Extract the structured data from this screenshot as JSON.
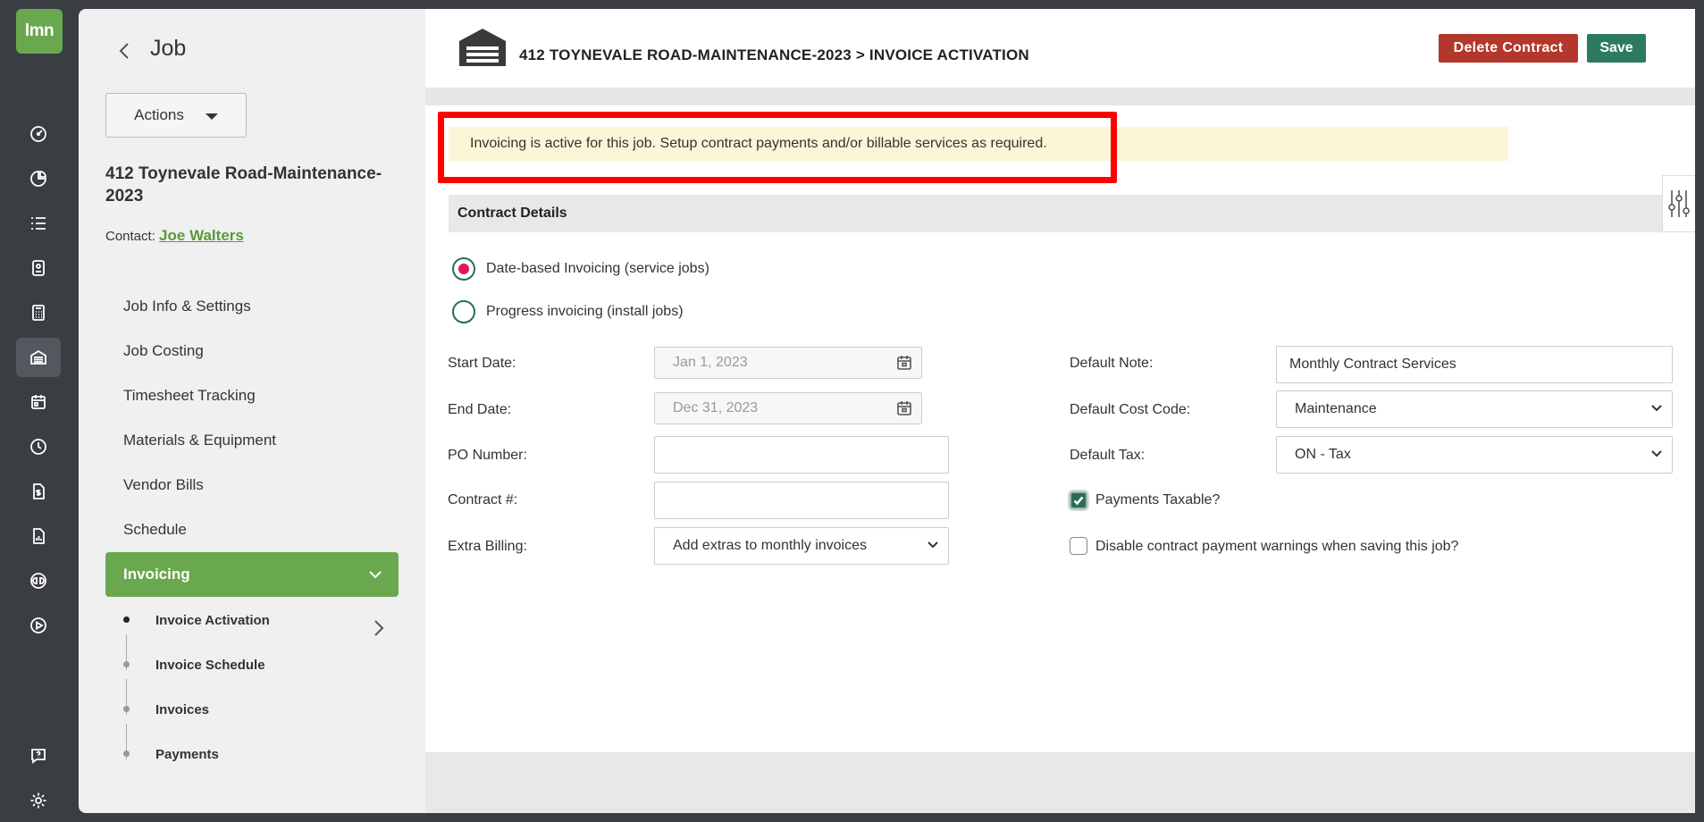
{
  "rail": {
    "logo": "lmn"
  },
  "sidebar": {
    "title": "Job",
    "actions_label": "Actions",
    "job_name": "412 Toynevale Road-Maintenance-2023",
    "contact_label": "Contact:",
    "contact_name": "Joe Walters",
    "nav": [
      "Job Info & Settings",
      "Job Costing",
      "Timesheet Tracking",
      "Materials & Equipment",
      "Vendor Bills",
      "Schedule"
    ],
    "active_nav": "Invoicing",
    "sub_nav": [
      "Invoice Activation",
      "Invoice Schedule",
      "Invoices",
      "Payments"
    ]
  },
  "header": {
    "breadcrumb": "412 TOYNEVALE ROAD-MAINTENANCE-2023 > INVOICE ACTIVATION",
    "delete_label": "Delete Contract",
    "save_label": "Save"
  },
  "notice": "Invoicing is active for this job. Setup contract payments and/or billable services as required.",
  "section_title": "Contract Details",
  "radios": {
    "date_based": "Date-based Invoicing (service jobs)",
    "progress": "Progress invoicing (install jobs)",
    "selected": "date_based"
  },
  "form": {
    "start_date_label": "Start Date:",
    "start_date": "Jan 1, 2023",
    "end_date_label": "End Date:",
    "end_date": "Dec 31, 2023",
    "po_label": "PO Number:",
    "po_value": "",
    "contract_label": "Contract #:",
    "contract_value": "",
    "extra_billing_label": "Extra Billing:",
    "extra_billing_value": "Add extras to monthly invoices",
    "default_note_label": "Default Note:",
    "default_note_value": "Monthly Contract Services",
    "default_cost_code_label": "Default Cost Code:",
    "default_cost_code_value": "Maintenance",
    "default_tax_label": "Default Tax:",
    "default_tax_value": "ON - Tax",
    "payments_taxable_label": "Payments Taxable?",
    "payments_taxable": true,
    "disable_warnings_label": "Disable contract payment warnings when saving this job?",
    "disable_warnings": false
  },
  "colors": {
    "brand_green": "#6aa84f",
    "delete_red": "#b3372b",
    "save_green": "#2e7a5e",
    "notice_bg": "#fcf6d6",
    "highlight_red": "#ff0000"
  }
}
